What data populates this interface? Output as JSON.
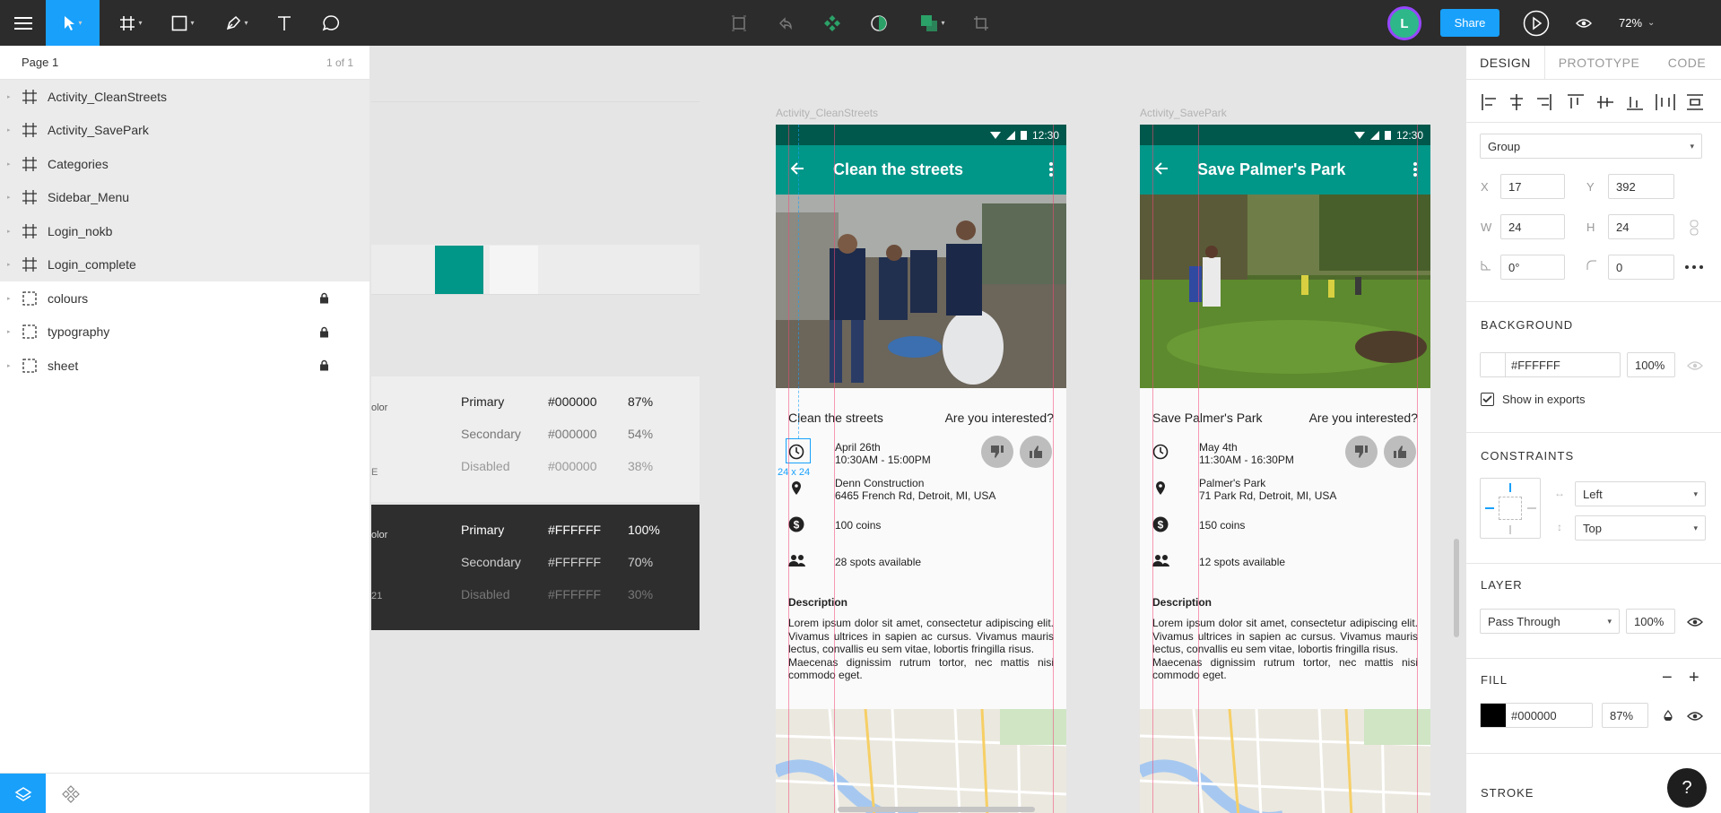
{
  "toolbar": {
    "zoom": "72%",
    "share_label": "Share",
    "avatar_initial": "L"
  },
  "pages": {
    "current": "Page 1",
    "count": "1 of 1"
  },
  "layers": [
    {
      "name": "Activity_CleanStreets",
      "type": "frame",
      "locked": false
    },
    {
      "name": "Activity_SavePark",
      "type": "frame",
      "locked": false
    },
    {
      "name": "Categories",
      "type": "frame",
      "locked": false
    },
    {
      "name": "Sidebar_Menu",
      "type": "frame",
      "locked": false
    },
    {
      "name": "Login_nokb",
      "type": "frame",
      "locked": false
    },
    {
      "name": "Login_complete",
      "type": "frame",
      "locked": false
    },
    {
      "name": "colours",
      "type": "group",
      "locked": true
    },
    {
      "name": "typography",
      "type": "group",
      "locked": true
    },
    {
      "name": "sheet",
      "type": "group",
      "locked": true
    }
  ],
  "colour_sheet": {
    "light_label_fragment": "olor",
    "dark_label_fragment": "olor",
    "dark_fragment_2": "21",
    "light_fragment_2": "E",
    "light_rows": [
      {
        "name": "Primary",
        "hex": "#000000",
        "opacity": "87%"
      },
      {
        "name": "Secondary",
        "hex": "#000000",
        "opacity": "54%"
      },
      {
        "name": "Disabled",
        "hex": "#000000",
        "opacity": "38%"
      }
    ],
    "dark_rows": [
      {
        "name": "Primary",
        "hex": "#FFFFFF",
        "opacity": "100%"
      },
      {
        "name": "Secondary",
        "hex": "#FFFFFF",
        "opacity": "70%"
      },
      {
        "name": "Disabled",
        "hex": "#FFFFFF",
        "opacity": "30%"
      }
    ],
    "swatch_colors": [
      "#009688",
      "#f5f5f5"
    ]
  },
  "frames": [
    {
      "label": "Activity_CleanStreets",
      "time": "12:30",
      "title": "Clean the streets",
      "heading": "Clean the streets",
      "interested": "Are you interested?",
      "date": "April 26th",
      "hours": "10:30AM - 15:00PM",
      "place": "Denn Construction",
      "address": "6465 French Rd, Detroit, MI, USA",
      "coins": "100 coins",
      "spots": "28 spots available",
      "description_title": "Description",
      "description_p1": "Lorem ipsum dolor sit amet, consectetur adipiscing elit. Vivamus ultrices in sapien ac cursus. Vivamus mauris lectus, convallis eu sem vitae, lobortis fringilla risus.",
      "description_p2": "Maecenas dignissim rutrum tortor, nec mattis nisi commodo eget.",
      "selection_size": "24 x 24"
    },
    {
      "label": "Activity_SavePark",
      "time": "12:30",
      "title": "Save Palmer's Park",
      "heading": "Save Palmer's Park",
      "interested": "Are you interested?",
      "date": "May 4th",
      "hours": "11:30AM - 16:30PM",
      "place": "Palmer's Park",
      "address": "71 Park Rd, Detroit, MI, USA",
      "coins": "150 coins",
      "spots": "12 spots available",
      "description_title": "Description",
      "description_p1": "Lorem ipsum dolor sit amet, consectetur adipiscing elit. Vivamus ultrices in sapien ac cursus. Vivamus mauris lectus, convallis eu sem vitae, lobortis fringilla risus.",
      "description_p2": "Maecenas dignissim rutrum tortor, nec mattis nisi commodo eget."
    }
  ],
  "design_panel": {
    "tabs": [
      "DESIGN",
      "PROTOTYPE",
      "CODE"
    ],
    "active_tab": "DESIGN",
    "layer_type": "Group",
    "x": "17",
    "y": "392",
    "w": "24",
    "h": "24",
    "rotation": "0°",
    "radius": "0",
    "labels": {
      "x": "X",
      "y": "Y",
      "w": "W",
      "h": "H"
    },
    "background_title": "BACKGROUND",
    "background_hex": "#FFFFFF",
    "background_opacity": "100%",
    "show_in_exports": "Show in exports",
    "constraints_title": "CONSTRAINTS",
    "constraint_h": "Left",
    "constraint_v": "Top",
    "layer_title": "LAYER",
    "blend_mode": "Pass Through",
    "layer_opacity": "100%",
    "fill_title": "FILL",
    "fill_hex": "#000000",
    "fill_opacity": "87%",
    "stroke_title": "STROKE",
    "accent": "#18a0fb"
  },
  "help_label": "?"
}
